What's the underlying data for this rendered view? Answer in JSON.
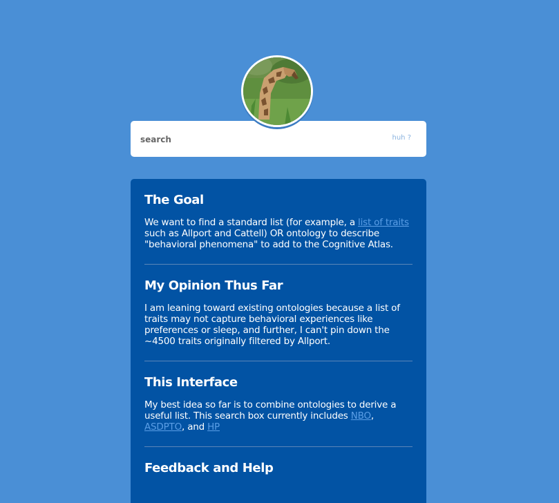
{
  "header": {
    "avatar_alt": "giraffe-photo"
  },
  "search": {
    "placeholder": "search",
    "help_label": "huh ?"
  },
  "sections": [
    {
      "title": "The Goal",
      "text_before": "We want to find a standard list (for example, a ",
      "link1": "list of traits ",
      "text_after": "such as Allport and Cattell) OR ontology to describe \"behavioral phenomena\" to add to the Cognitive Atlas."
    },
    {
      "title": "My Opinion Thus Far",
      "text": "I am leaning toward existing ontologies because a list of traits may not capture behavioral experiences like preferences or sleep, and further, I can't pin down the ~4500 traits originally filtered by Allport."
    },
    {
      "title": "This Interface",
      "text_before": "My best idea so far is to combine ontologies to derive a useful list. This search box currently includes ",
      "link1": "NBO",
      "sep1": ", ",
      "link2": "ASDPTO",
      "sep2": ", and ",
      "link3": "HP"
    },
    {
      "title": "Feedback and Help"
    }
  ]
}
